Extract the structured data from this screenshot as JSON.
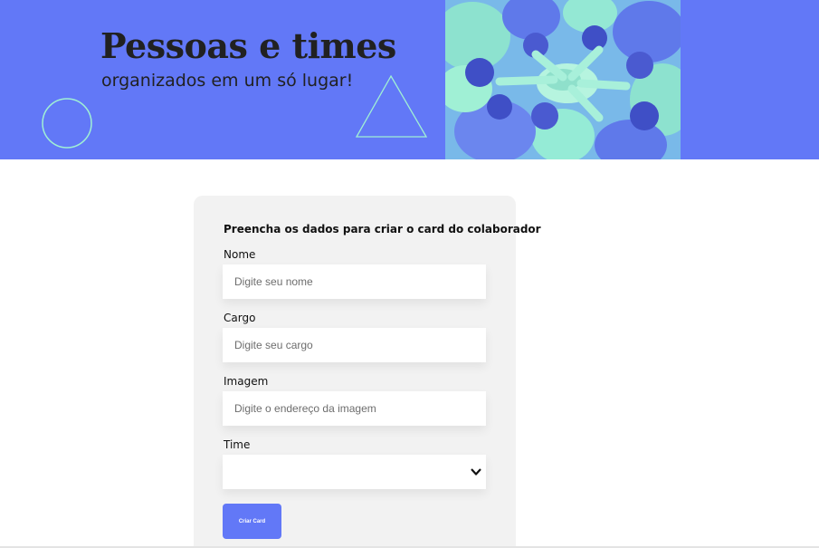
{
  "banner": {
    "title": "Pessoas e times",
    "subtitle": "organizados em um só lugar!"
  },
  "form": {
    "heading": "Preencha os dados para criar o card do colaborador",
    "fields": {
      "nome": {
        "label": "Nome",
        "placeholder": "Digite seu nome"
      },
      "cargo": {
        "label": "Cargo",
        "placeholder": "Digite seu cargo"
      },
      "imagem": {
        "label": "Imagem",
        "placeholder": "Digite o endereço da imagem"
      },
      "time": {
        "label": "Time",
        "selected": ""
      }
    },
    "submit_label": "Criar Card"
  },
  "colors": {
    "primary": "#6278f7",
    "decoration": "#a0f0d5",
    "card_bg": "#f2f2f2"
  }
}
